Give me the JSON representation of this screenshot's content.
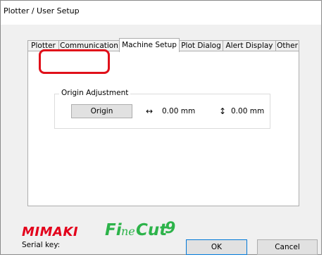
{
  "window": {
    "title": "Plotter / User Setup"
  },
  "tabs": [
    {
      "label": "Plotter",
      "active": false
    },
    {
      "label": "Communication",
      "active": false
    },
    {
      "label": "Machine Setup",
      "active": true
    },
    {
      "label": "Plot Dialog",
      "active": false
    },
    {
      "label": "Alert Display",
      "active": false
    },
    {
      "label": "Other",
      "active": false
    }
  ],
  "origin_adjustment": {
    "group_label": "Origin Adjustment",
    "origin_button": "Origin",
    "x_value": "0.00 mm",
    "y_value": "0.00 mm",
    "x_icon": "horizontal-arrow-icon",
    "y_icon": "vertical-arrow-icon"
  },
  "branding": {
    "maker_logo": "MIMAKI",
    "product_logo": "FineCut 9",
    "maker_color": "#e3001b",
    "product_color": "#2db34a"
  },
  "footer": {
    "serial_label": "Serial key:",
    "ok_label": "OK",
    "cancel_label": "Cancel"
  },
  "colors": {
    "highlight": "#e0101a",
    "default_button_border": "#0078d7"
  }
}
